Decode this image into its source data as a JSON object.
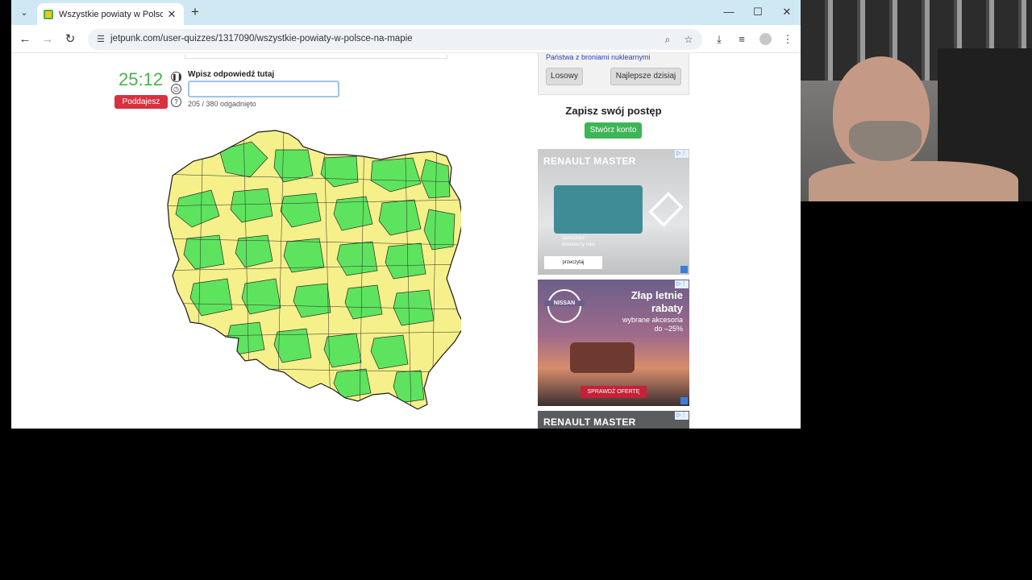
{
  "browser": {
    "tab": {
      "title": "Wszystkie powiaty w Polsce na"
    },
    "url": "jetpunk.com/user-quizzes/1317090/wszystkie-powiaty-w-polsce-na-mapie"
  },
  "quiz": {
    "timer": "25:12",
    "give_up_label": "Poddajesz się?",
    "answer_label": "Wpisz odpowiedź tutaj",
    "answer_value": "",
    "progress": "205 / 380 odgadnięto"
  },
  "sidebar": {
    "related_link": "Państwa z broniami nuklearnymi",
    "random_button": "Losowy",
    "best_today_button": "Najlepsze dzisiaj",
    "save_heading": "Zapisz swój postęp",
    "create_account_button": "Stwórz konto"
  },
  "ads": {
    "renault_1": {
      "brand": "RENAULT MASTER",
      "caption_line1": "samochód",
      "caption_line2": "dostawczy roku",
      "cta": "przeczytaj"
    },
    "nissan": {
      "brand": "NISSAN",
      "headline_1": "Złap letnie",
      "headline_2": "rabaty",
      "sub_1": "wybrane akcesoria",
      "sub_2": "do –25%",
      "cta": "SPRAWDŹ OFERTĘ"
    },
    "renault_2": {
      "brand": "RENAULT MASTER"
    }
  },
  "colors": {
    "guessed": "#5ee35e",
    "unguessed": "#f5f08a",
    "timer": "#4caf50",
    "give_up": "#d9303e",
    "create_account": "#3db555"
  },
  "icons": {
    "pause": "pause-icon",
    "clock": "clock-icon",
    "help": "help-icon"
  }
}
